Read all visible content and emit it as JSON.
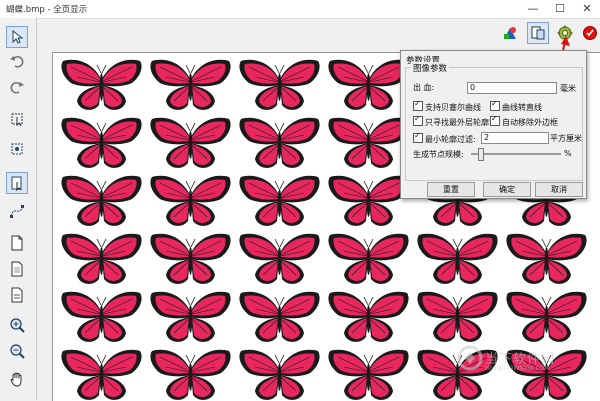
{
  "window": {
    "title": "蝴蝶.bmp - 全页显示",
    "minimize": "—",
    "maximize": "☐",
    "close": "✕"
  },
  "left_toolbar": {
    "tools": [
      "pointer-icon",
      "undo-icon",
      "redo-icon",
      "select-node-icon",
      "transform-icon",
      "page-select-icon",
      "bezier-edit-icon",
      "new-page-icon",
      "page-icon",
      "page-alt-icon",
      "zoom-in-icon",
      "zoom-out-icon",
      "hand-pan-icon"
    ]
  },
  "top_toolbar": {
    "tools": [
      "color-shapes-icon",
      "trace-settings-icon",
      "gear-icon",
      "record-icon"
    ]
  },
  "dialog": {
    "title": "参数设置",
    "group_label": "图像参数",
    "bleed_label": "出    血:",
    "bleed_value": "0",
    "bleed_unit": "毫米",
    "cb_bezier": "支持贝塞尔曲线",
    "cb_curve_to_line": "曲线转直线",
    "cb_outer_contour": "只寻找最外层轮廓",
    "cb_auto_remove_border": "自动移除外边框",
    "cb_min_contour": "最小轮廓过滤:",
    "min_contour_value": "2",
    "min_contour_unit": "平方厘米",
    "node_scale_label": "生成节点规模:",
    "node_scale_unit": "%",
    "reset_button": "重置",
    "ok_button": "确定",
    "cancel_button": "取消",
    "checked": {
      "bezier": true,
      "curve_to_line": true,
      "outer_contour": true,
      "auto_remove_border": true,
      "min_contour": true
    }
  },
  "canvas": {
    "rows": 6,
    "cols": 6
  },
  "colors": {
    "wing_pink": "#e8275f",
    "wing_dark": "#1a1a1a",
    "accent_red": "#d11"
  },
  "watermark": {
    "text": "当下软件园",
    "sub": "WWW.DOWNXIA.COM"
  }
}
